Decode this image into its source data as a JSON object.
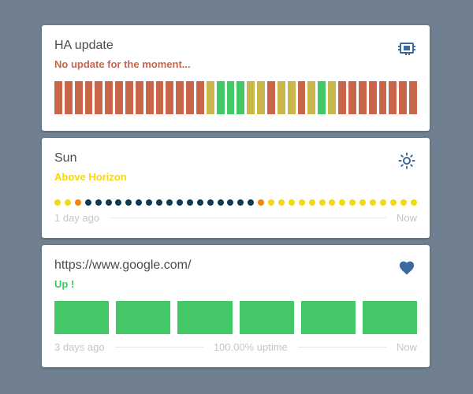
{
  "colors": {
    "background": "#708090",
    "red": "#c9664a",
    "green": "#44c767",
    "olive": "#c9b64a",
    "navy": "#0e3a52",
    "yellow": "#f5d70f",
    "orange": "#f5840c",
    "icon": "#3d6a9c"
  },
  "cards": {
    "ha_update": {
      "title": "HA update",
      "status": "No update for the moment...",
      "status_color": "#c9664a",
      "icon": "chip-icon",
      "bars": [
        "red",
        "red",
        "red",
        "red",
        "red",
        "red",
        "red",
        "red",
        "red",
        "red",
        "red",
        "red",
        "red",
        "red",
        "red",
        "olive",
        "green",
        "green",
        "green",
        "olive",
        "olive",
        "red",
        "olive",
        "olive",
        "red",
        "olive",
        "green",
        "olive",
        "red",
        "red",
        "red",
        "red",
        "red",
        "red",
        "red",
        "red"
      ]
    },
    "sun": {
      "title": "Sun",
      "status": "Above Horizon",
      "status_color": "#f5d70f",
      "icon": "sun-icon",
      "dots": [
        "yellow",
        "yellow",
        "orange",
        "navy",
        "navy",
        "navy",
        "navy",
        "navy",
        "navy",
        "navy",
        "navy",
        "navy",
        "navy",
        "navy",
        "navy",
        "navy",
        "navy",
        "navy",
        "navy",
        "navy",
        "orange",
        "yellow",
        "yellow",
        "yellow",
        "yellow",
        "yellow",
        "yellow",
        "yellow",
        "yellow",
        "yellow",
        "yellow",
        "yellow",
        "yellow",
        "yellow",
        "yellow",
        "yellow"
      ],
      "footer_left": "1 day ago",
      "footer_right": "Now"
    },
    "google": {
      "title": "https://www.google.com/",
      "status": "Up !",
      "status_color": "#44c767",
      "icon": "heart-icon",
      "bar_count": 6,
      "footer_left": "3 days ago",
      "footer_center": "100.00% uptime",
      "footer_right": "Now"
    }
  }
}
